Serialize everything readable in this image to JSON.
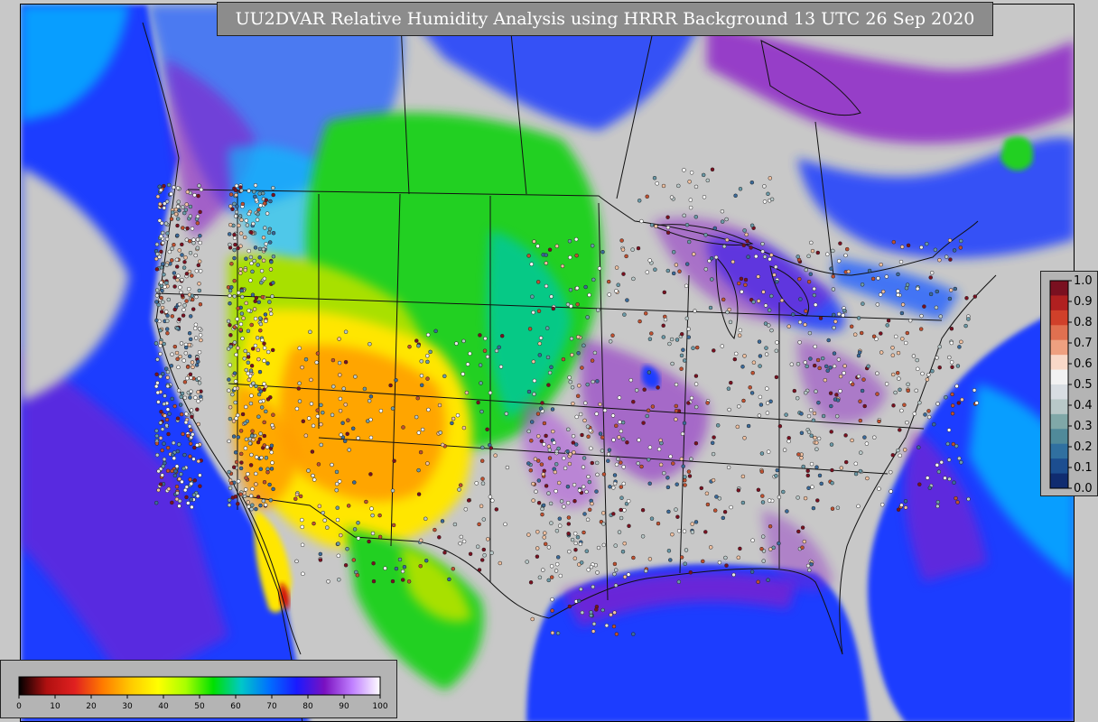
{
  "title": "UU2DVAR Relative Humidity Analysis using HRRR Background 13 UTC 26 Sep 2020",
  "colors": {
    "land_gray": "#c8c8c8",
    "ocean_deep": "#1a3cff",
    "ocean_blue": "#2060ff",
    "purple": "#8a1dc8",
    "violet": "#b04fe0",
    "cyan": "#00c8ff",
    "teal": "#00c8a0",
    "green": "#20d020",
    "lime": "#a8e000",
    "yellow": "#ffe600",
    "orange": "#ff9a00",
    "red": "#d01010",
    "boundary": "#111111"
  },
  "legend_rh": {
    "labels": [
      "0",
      "10",
      "20",
      "30",
      "40",
      "50",
      "60",
      "70",
      "80",
      "90",
      "100"
    ],
    "colors": [
      "#000000",
      "#b01010",
      "#e02020",
      "#ff7a00",
      "#ffc800",
      "#ffff00",
      "#a8ff00",
      "#00e000",
      "#00c8c8",
      "#0070ff",
      "#1a1aff",
      "#7a10c0",
      "#c080ff",
      "#ffffff"
    ]
  },
  "legend_error": {
    "labels": [
      "1.0",
      "0.9",
      "0.8",
      "0.7",
      "0.6",
      "0.5",
      "0.4",
      "0.3",
      "0.2",
      "0.1",
      "0.0"
    ],
    "colors": [
      "#7a1020",
      "#b02020",
      "#d0402a",
      "#e07050",
      "#eea080",
      "#f8d8c8",
      "#f2f2f2",
      "#d8dde2",
      "#b8c8c8",
      "#80a8a8",
      "#508a9a",
      "#3070a0",
      "#1c4e90",
      "#102c70"
    ]
  }
}
